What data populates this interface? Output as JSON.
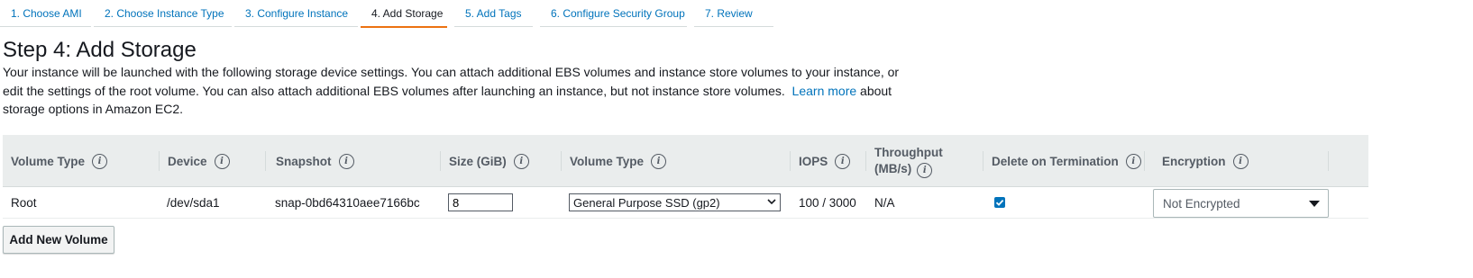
{
  "tabs": [
    {
      "label": "1. Choose AMI"
    },
    {
      "label": "2. Choose Instance Type"
    },
    {
      "label": "3. Configure Instance"
    },
    {
      "label": "4. Add Storage",
      "active": true
    },
    {
      "label": "5. Add Tags"
    },
    {
      "label": "6. Configure Security Group"
    },
    {
      "label": "7. Review"
    }
  ],
  "page": {
    "title": "Step 4: Add Storage",
    "description_part1": "Your instance will be launched with the following storage device settings. You can attach additional EBS volumes and instance store volumes to your instance, or edit the settings of the root volume. You can also attach additional EBS volumes after launching an instance, but not instance store volumes.",
    "learn_more": "Learn more",
    "description_part2": "about storage options in Amazon EC2."
  },
  "table": {
    "headers": {
      "volume_type": "Volume Type",
      "device": "Device",
      "snapshot": "Snapshot",
      "size": "Size (GiB)",
      "volume_type2": "Volume Type",
      "iops": "IOPS",
      "throughput_line1": "Throughput",
      "throughput_line2": "(MB/s)",
      "delete_on_termination": "Delete on Termination",
      "encryption": "Encryption"
    },
    "rows": [
      {
        "volume_type": "Root",
        "device": "/dev/sda1",
        "snapshot": "snap-0bd64310aee7166bc",
        "size": "8",
        "ebs_volume_type": "General Purpose SSD (gp2)",
        "iops": "100 / 3000",
        "throughput": "N/A",
        "delete_on_termination": true,
        "encryption": "Not Encrypted"
      }
    ]
  },
  "actions": {
    "add_new_volume": "Add New Volume"
  },
  "icons": {
    "info": "info-icon",
    "chevron": "chevron-down-icon",
    "checkbox": "checkbox-checked-icon"
  },
  "colors": {
    "link": "#0073bb",
    "active_tab_underline": "#ec7211",
    "header_bg": "#eaeded",
    "checkbox": "#0073bb"
  }
}
